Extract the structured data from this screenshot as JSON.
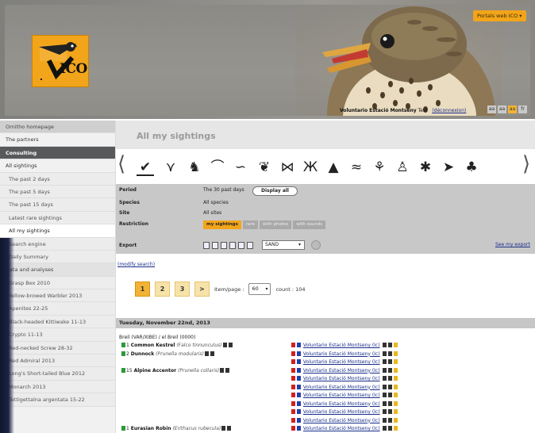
{
  "header": {
    "lang_button": "Portals web ICO ▾",
    "logo_text": "ICO",
    "user_name": "Voluntario Estació Montseny",
    "user_extra": "Test",
    "user_link": "(déconnexion)",
    "font_buttons": [
      "aa",
      "aa",
      "aa",
      "fr"
    ]
  },
  "sidebar": {
    "items": [
      "Ornitho homepage",
      "The partners",
      "Consulting",
      "All sightings",
      "The past 2 days",
      "The past 5 days",
      "The past 15 days",
      "Latest rare sightings",
      "All my sightings",
      "Search engine",
      "Daily Summary",
      "Data and analyses",
      "Grasp Bex 2010",
      "Yellow-browed Warbler 2013",
      "Apenites 22-25",
      "Black-headed Kittiwake 11-13",
      "Crypto 11-13",
      "Red-necked Screw 28-32",
      "Red Admiral 2013",
      "Long's Short-tailed Blue 2012",
      "Monarch 2013",
      "Tettigettalna argentata 15-22"
    ]
  },
  "main": {
    "title": "All my sightings",
    "filters": {
      "period_label": "Period",
      "period_value": "The 30 past days",
      "display_all": "Display all",
      "species_label": "Species",
      "species_value": "All species",
      "site_label": "Site",
      "site_value": "All sites",
      "restriction_label": "Restriction",
      "restriction_tabs": [
        "my sightings",
        "rare",
        "with photos",
        "with sounds"
      ],
      "export_label": "Export",
      "export_format": "SAND",
      "export_link": "See my export"
    },
    "modify_link": "(modify search)",
    "pager": {
      "pages": [
        "1",
        "2",
        "3",
        ">"
      ],
      "per_page_label": "Item/page :",
      "per_page_value": "60",
      "count_label": "count : 104"
    },
    "date_header": "Tuesday, November 22nd, 2013",
    "place": "Breil (VAR/XIBE) / el Breil (0000)",
    "rows": [
      {
        "count": "1",
        "name": "Common Kestrel",
        "sci": "(Falco tinnunculus)",
        "observer": "Voluntario Estació Montseny (Ic)"
      },
      {
        "count": "2",
        "name": "Dunnock",
        "sci": "(Prunella modularis)",
        "observer": "Voluntario Estació Montseny (Ic)"
      },
      {
        "count": "",
        "name": "",
        "sci": "",
        "observer": "Voluntario Estació Montseny (Ic)"
      },
      {
        "count": "15",
        "name": "Alpine Accentor",
        "sci": "(Prunella collaris)",
        "observer": "Voluntario Estació Montseny (Ic)"
      },
      {
        "count": "",
        "name": "",
        "sci": "",
        "observer": "Voluntario Estació Montseny (Ic)"
      },
      {
        "count": "",
        "name": "",
        "sci": "",
        "observer": "Voluntario Estació Montseny (Ic)"
      },
      {
        "count": "",
        "name": "",
        "sci": "",
        "observer": "Voluntario Estació Montseny (Ic)"
      },
      {
        "count": "",
        "name": "",
        "sci": "",
        "observer": "Voluntario Estació Montseny (Ic)"
      },
      {
        "count": "",
        "name": "",
        "sci": "",
        "observer": "Voluntario Estació Montseny (Ic)"
      },
      {
        "count": "",
        "name": "",
        "sci": "",
        "observer": "Voluntario Estació Montseny (Ic)"
      },
      {
        "count": "1",
        "name": "Eurasian Robin",
        "sci": "(Erithacus rubecula)",
        "observer": "Voluntario Estació Montseny (Ic)"
      }
    ]
  },
  "colors": {
    "accent": "#f2a51a",
    "sidebar_active": "#58595b",
    "link": "#1a2e8a"
  }
}
